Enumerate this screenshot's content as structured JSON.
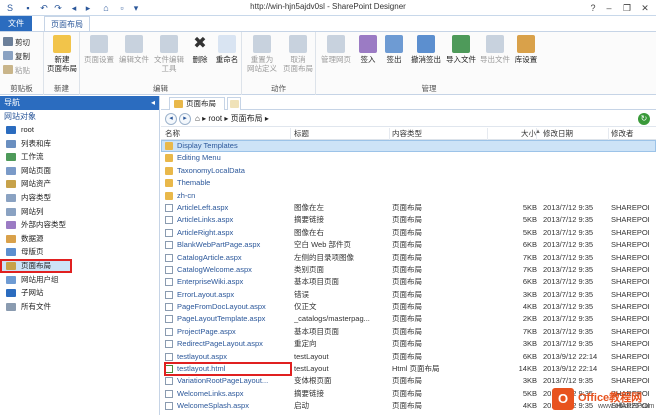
{
  "window": {
    "title": "http://win-hjn5ajdv0sl - SharePoint Designer",
    "controls": [
      "?",
      "–",
      "❐",
      "✕"
    ]
  },
  "tabs": {
    "file": "文件",
    "layout": "页面布局"
  },
  "ribbon": {
    "clipboard": {
      "label": "剪贴板",
      "cut": "剪切",
      "copy": "复制",
      "paste": "粘贴"
    },
    "new": {
      "label": "新建",
      "new_layout_line1": "新建",
      "new_layout_line2": "页面布局"
    },
    "edit": {
      "label": "编辑",
      "page_settings": "页面设置",
      "edit_file": "编辑文件",
      "file_edit_tools_line1": "文件编辑",
      "file_edit_tools_line2": "工具",
      "delete": "删除",
      "rename": "重命名"
    },
    "actions": {
      "label": "动作",
      "reset_line1": "重置为",
      "reset_line2": "网站定义",
      "cancel_line1": "取消",
      "cancel_line2": "页面布局"
    },
    "manage": {
      "label": "管理",
      "web_manage": "管理网页",
      "check_in": "签入",
      "check_out": "签出",
      "undo_check_out": "撤消签出",
      "import_file": "导入文件",
      "export_file": "导出文件",
      "library_settings": "库设置"
    }
  },
  "nav": {
    "header": "导航",
    "section": "网站对象",
    "items": [
      "root",
      "列表和库",
      "工作流",
      "网站页面",
      "网站资产",
      "内容类型",
      "网站列",
      "外部内容类型",
      "数据源",
      "母版页",
      "页面布局",
      "网站用户组",
      "子网站",
      "所有文件"
    ]
  },
  "doc_tab": {
    "label": "页面布局"
  },
  "breadcrumb": {
    "root": "root",
    "sep": "▸",
    "current": "页面布局"
  },
  "columns": {
    "name": "名称",
    "title": "标题",
    "type": "内容类型",
    "size": "大小",
    "date": "修改日期",
    "modified_by": "修改者"
  },
  "rows": [
    {
      "kind": "folder",
      "name": "Display Templates",
      "title": "",
      "type": "",
      "size": "",
      "date": "",
      "by": ""
    },
    {
      "kind": "folder",
      "name": "Editing Menu",
      "title": "",
      "type": "",
      "size": "",
      "date": "",
      "by": ""
    },
    {
      "kind": "folder",
      "name": "TaxonomyLocalData",
      "title": "",
      "type": "",
      "size": "",
      "date": "",
      "by": ""
    },
    {
      "kind": "folder",
      "name": "Themable",
      "title": "",
      "type": "",
      "size": "",
      "date": "",
      "by": ""
    },
    {
      "kind": "folder",
      "name": "zh-cn",
      "title": "",
      "type": "",
      "size": "",
      "date": "",
      "by": ""
    },
    {
      "kind": "page",
      "name": "ArticleLeft.aspx",
      "title": "图像在左",
      "type": "页面布局",
      "size": "5KB",
      "date": "2013/7/12 9:35",
      "by": "SHAREPOI"
    },
    {
      "kind": "page",
      "name": "ArticleLinks.aspx",
      "title": "摘要链接",
      "type": "页面布局",
      "size": "5KB",
      "date": "2013/7/12 9:35",
      "by": "SHAREPOI"
    },
    {
      "kind": "page",
      "name": "ArticleRight.aspx",
      "title": "图像在右",
      "type": "页面布局",
      "size": "5KB",
      "date": "2013/7/12 9:35",
      "by": "SHAREPOI"
    },
    {
      "kind": "page",
      "name": "BlankWebPartPage.aspx",
      "title": "空白 Web 部件页",
      "type": "页面布局",
      "size": "6KB",
      "date": "2013/7/12 9:35",
      "by": "SHAREPOI"
    },
    {
      "kind": "page",
      "name": "CatalogArticle.aspx",
      "title": "左侧的目录项图像",
      "type": "页面布局",
      "size": "7KB",
      "date": "2013/7/12 9:35",
      "by": "SHAREPOI"
    },
    {
      "kind": "page",
      "name": "CatalogWelcome.aspx",
      "title": "类别页面",
      "type": "页面布局",
      "size": "7KB",
      "date": "2013/7/12 9:35",
      "by": "SHAREPOI"
    },
    {
      "kind": "page",
      "name": "EnterpriseWiki.aspx",
      "title": "基本项目页面",
      "type": "页面布局",
      "size": "6KB",
      "date": "2013/7/12 9:35",
      "by": "SHAREPOI"
    },
    {
      "kind": "page",
      "name": "ErrorLayout.aspx",
      "title": "错误",
      "type": "页面布局",
      "size": "3KB",
      "date": "2013/7/12 9:35",
      "by": "SHAREPOI"
    },
    {
      "kind": "page",
      "name": "PageFromDocLayout.aspx",
      "title": "仅正文",
      "type": "页面布局",
      "size": "4KB",
      "date": "2013/7/12 9:35",
      "by": "SHAREPOI"
    },
    {
      "kind": "page",
      "name": "PageLayoutTemplate.aspx",
      "title": "_catalogs/masterpag...",
      "type": "页面布局",
      "size": "2KB",
      "date": "2013/7/12 9:35",
      "by": "SHAREPOI"
    },
    {
      "kind": "page",
      "name": "ProjectPage.aspx",
      "title": "基本项目页面",
      "type": "页面布局",
      "size": "7KB",
      "date": "2013/7/12 9:35",
      "by": "SHAREPOI"
    },
    {
      "kind": "page",
      "name": "RedirectPageLayout.aspx",
      "title": "重定向",
      "type": "页面布局",
      "size": "3KB",
      "date": "2013/7/12 9:35",
      "by": "SHAREPOI"
    },
    {
      "kind": "page",
      "name": "testlayout.aspx",
      "title": "testLayout",
      "type": "页面布局",
      "size": "6KB",
      "date": "2013/9/12 22:14",
      "by": "SHAREPOI"
    },
    {
      "kind": "html",
      "name": "testlayout.html",
      "title": "testLayout",
      "type": "Html 页面布局",
      "size": "14KB",
      "date": "2013/9/12 22:14",
      "by": "SHAREPOI"
    },
    {
      "kind": "page",
      "name": "VariationRootPageLayout...",
      "title": "变体根页面",
      "type": "页面布局",
      "size": "3KB",
      "date": "2013/7/12 9:35",
      "by": "SHAREPOI"
    },
    {
      "kind": "page",
      "name": "WelcomeLinks.aspx",
      "title": "摘要链接",
      "type": "页面布局",
      "size": "5KB",
      "date": "2013/7/12 9:35",
      "by": "SHAREPOI"
    },
    {
      "kind": "page",
      "name": "WelcomeSplash.aspx",
      "title": "启动",
      "type": "页面布局",
      "size": "4KB",
      "date": "2013/7/12 9:35",
      "by": "SHAREPOI"
    }
  ],
  "watermark": {
    "title": "Office教程网",
    "site": "www.office26.com"
  },
  "colors": {
    "accent": "#2b6cbf",
    "selection": "#cde3f7",
    "highlight": "#e02020"
  }
}
